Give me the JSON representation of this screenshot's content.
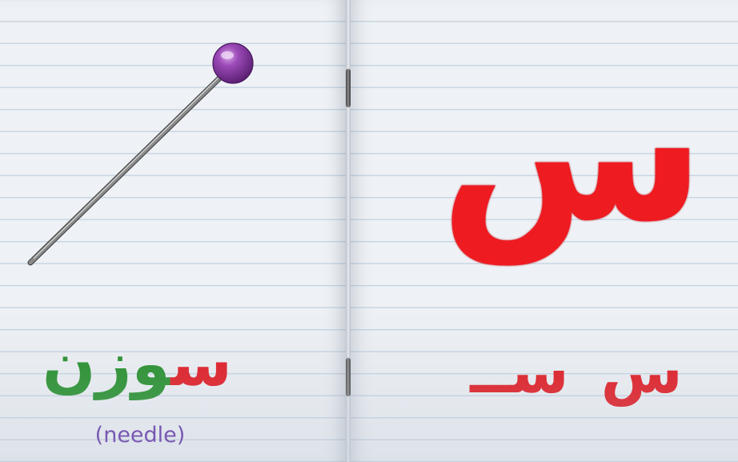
{
  "left_page": {
    "picture_icon": "pin-needle",
    "word": {
      "first_letter": "س",
      "rest": "وزن"
    },
    "translation": "(needle)",
    "colors": {
      "first_letter": "#e2121a",
      "rest": "#1e8c23",
      "translation": "#5c2aa6"
    }
  },
  "right_page": {
    "big_letter": "س",
    "forms": [
      "س",
      "ســ"
    ],
    "color": "#ee1b21"
  }
}
